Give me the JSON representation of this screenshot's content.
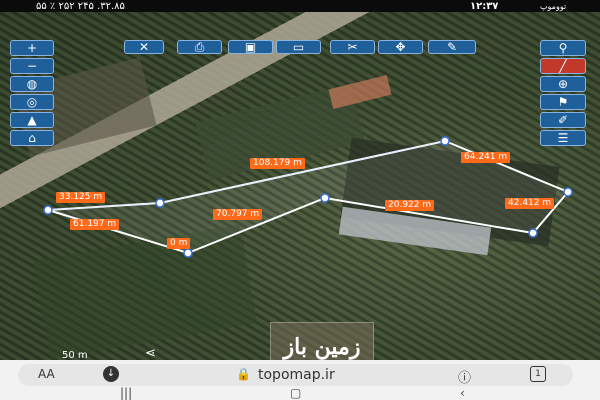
{
  "status_bar": {
    "left_text": "۵۵ ٪ ۲۵۲ ۲۴۵ .۳۲.۸۵",
    "time": "۱۲:۳۷",
    "app_name": "تووموپ"
  },
  "map": {
    "length_labels": [
      "108.179 m",
      "64.241 m",
      "33.125 m",
      "61.197 m",
      "70.797 m",
      "20.922 m",
      "42.412 m",
      "0 m"
    ],
    "scale_label": "50 m",
    "watermark_text": "زمین باز"
  },
  "toolbar_top_icons": [
    "close-icon",
    "print-icon",
    "save-icon",
    "folder-icon",
    "cut-icon",
    "move-icon",
    "pen-icon"
  ],
  "toolbar_left_icons": [
    "zoom-in-icon",
    "zoom-out-icon",
    "globe-icon",
    "layers-icon",
    "terrain-icon",
    "home-icon"
  ],
  "toolbar_right_icons": [
    "search-icon",
    "draw-line-icon",
    "globe-icon",
    "location-icon",
    "edit-icon",
    "list-icon"
  ],
  "browser": {
    "text_size": "AA",
    "url": "topomap.ir",
    "tab_count": "1"
  },
  "colors": {
    "toolbar_bg": "#1f5f9a",
    "label_bg": "#ff6a1a",
    "polygon_stroke": "#ffffff"
  }
}
